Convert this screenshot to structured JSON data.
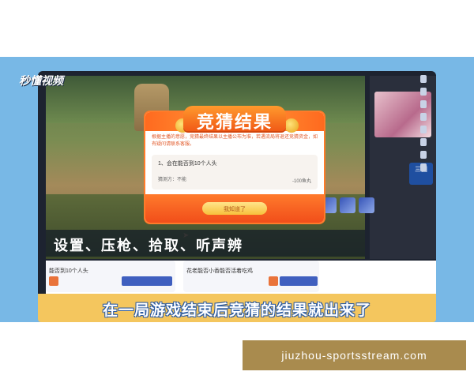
{
  "video": {
    "logo": "秒懂视频",
    "subtitle": "在一局游戏结束后竞猜的结果就出来了"
  },
  "game_overlay": {
    "tip_text": "设置、压枪、拾取、听声辨"
  },
  "modal": {
    "title": "竞猜结果",
    "note": "根据主播的意愿，竞猜最终结果以主播公布为准，若遇流局将退还竞猜资金，如有疑问请联系客服。",
    "question": "1、会在能否到10个人头",
    "my_answer": "猜测方：不能",
    "amount": "-100鱼丸",
    "button": "我知道了"
  },
  "page": {
    "card1_title": "能否到10个人头",
    "card2_title": "花老能否小香能否活着吃鸡"
  },
  "watermark": "jiuzhou-sportsstream.com"
}
